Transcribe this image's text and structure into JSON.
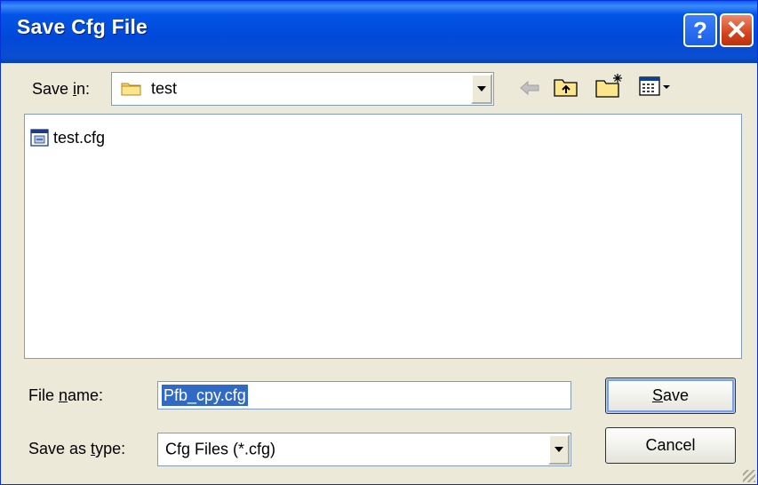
{
  "window": {
    "title": "Save Cfg File",
    "help_label": "?",
    "close_label": "✕"
  },
  "toolbar": {
    "save_in_label_pre": "Save ",
    "save_in_label_u": "i",
    "save_in_label_post": "n:",
    "folder": "test",
    "icons": [
      "back-arrow-icon",
      "up-folder-icon",
      "new-folder-icon",
      "view-menu-icon"
    ]
  },
  "files": [
    {
      "name": "test.cfg",
      "icon": "cfg-file-icon"
    }
  ],
  "form": {
    "filename_label_pre": "File ",
    "filename_label_u": "n",
    "filename_label_post": "ame:",
    "filename_value": "Pfb_cpy.cfg",
    "type_label_pre": "Save as ",
    "type_label_u": "t",
    "type_label_post": "ype:",
    "type_value": "Cfg Files (*.cfg)"
  },
  "buttons": {
    "save_u": "S",
    "save_rest": "ave",
    "cancel": "Cancel"
  },
  "colors": {
    "titlebar": "#0054e3",
    "close": "#d4441d",
    "selection": "#316ac5"
  }
}
